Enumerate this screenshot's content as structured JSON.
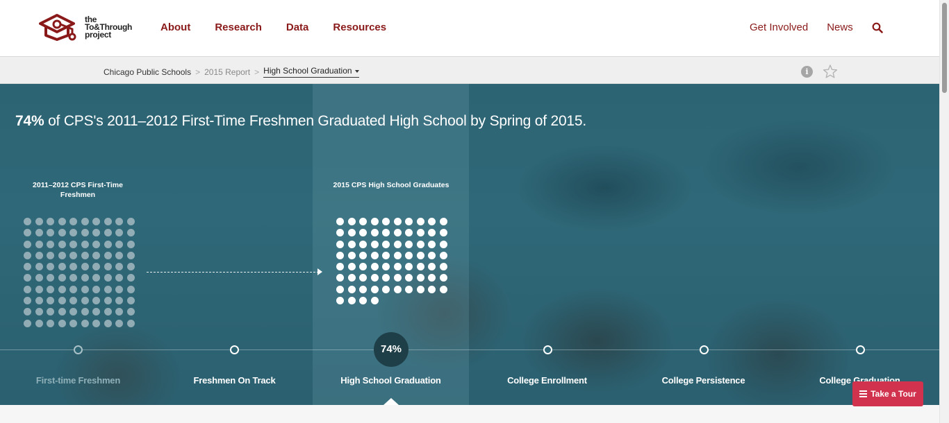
{
  "header": {
    "logo_lines": [
      "the",
      "To&Through",
      "project"
    ],
    "nav_left": [
      "About",
      "Research",
      "Data",
      "Resources"
    ],
    "nav_right": [
      "Get Involved",
      "News"
    ]
  },
  "breadcrumb": {
    "items": [
      "Chicago Public Schools",
      "2015 Report"
    ],
    "current": "High School Graduation"
  },
  "hero": {
    "headline_bold": "74%",
    "headline_rest": " of CPS's 2011–2012 First-Time Freshmen Graduated High School by Spring of 2015.",
    "left_label": "2011–2012 CPS First-Time Freshmen",
    "right_label": "2015 CPS High School Graduates",
    "left_dots": 100,
    "right_dots": 74,
    "active_value": "74%"
  },
  "timeline": {
    "steps": [
      "First-time Freshmen",
      "Freshmen On Track",
      "High School Graduation",
      "College Enrollment",
      "College Persistence",
      "College Graduation"
    ],
    "active_index": 2
  },
  "tour": {
    "label": "Take a Tour"
  },
  "colors": {
    "brand": "#8a1a1a",
    "hero": "#2d6474",
    "tour": "#d1324e"
  }
}
